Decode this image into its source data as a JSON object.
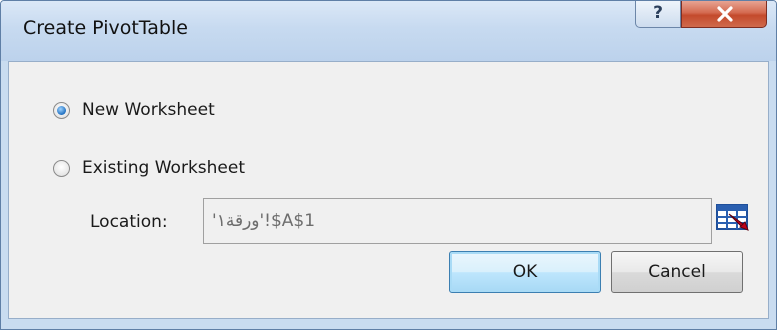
{
  "dialog": {
    "title": "Create PivotTable",
    "help_glyph": "?",
    "close_glyph": "x"
  },
  "options": {
    "new_worksheet_label": "New Worksheet",
    "existing_worksheet_label": "Existing Worksheet",
    "selected": "New Worksheet"
  },
  "location": {
    "label": "Location:",
    "value": "'ورقة١'!$A$1"
  },
  "buttons": {
    "ok_label": "OK",
    "cancel_label": "Cancel"
  },
  "icons": {
    "help": "question-mark-icon",
    "close": "close-icon",
    "collapse": "collapse-dialog-icon"
  },
  "colors": {
    "client_background": "#f0f0f0",
    "titlebar": "#c9dcf0",
    "close_button": "#c44a2c",
    "ok_button_focus": "#3c7fb1"
  }
}
